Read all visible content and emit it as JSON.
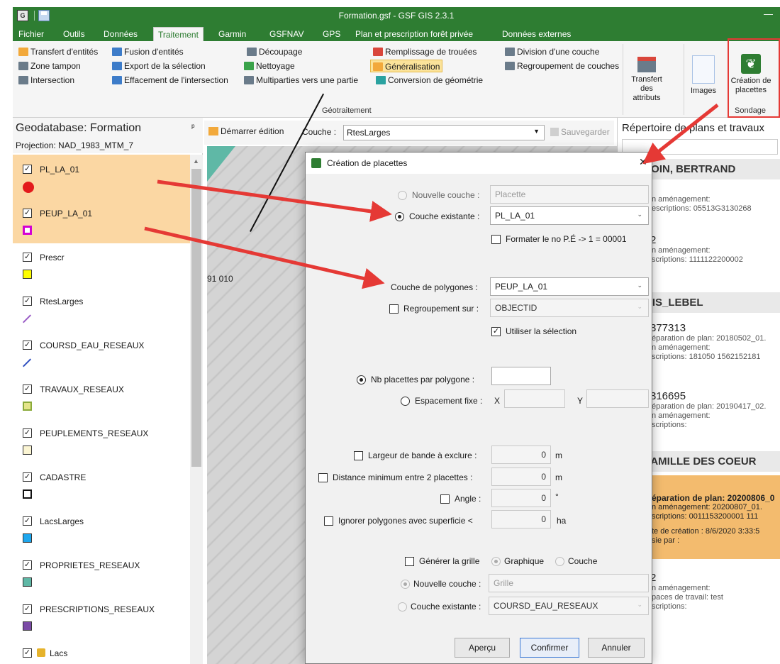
{
  "window": {
    "title": "Formation.gsf - GSF GIS 2.3.1",
    "app_icon_text": "G",
    "minimize_glyph": "—"
  },
  "tabs": [
    "Fichier",
    "Outils",
    "Données",
    "Traitement",
    "Garmin",
    "GSFNAV",
    "GPS",
    "Plan et prescription forêt privée",
    "Données externes"
  ],
  "ribbon": {
    "col1": [
      "Transfert d'entités",
      "Zone tampon",
      "Intersection"
    ],
    "col2": [
      "Fusion d'entités",
      "Export de la sélection",
      "Effacement de l'intersection"
    ],
    "col3": [
      "Découpage",
      "Nettoyage",
      "Multiparties vers une partie"
    ],
    "col4": [
      "Remplissage de trouées",
      "Généralisation",
      "Conversion de géométrie"
    ],
    "col5": [
      "Division d'une couche",
      "Regroupement de couches"
    ],
    "group_geotraitement": "Géotraitement",
    "transfert_label": "Transfert des attributs",
    "images_label": "Images",
    "creation_label": "Création de placettes",
    "group_sondage": "Sondage"
  },
  "left_panel": {
    "title": "Geodatabase: Formation",
    "pin": "ᵖ",
    "projection": "Projection: NAD_1983_MTM_7",
    "layers": [
      {
        "name": "PL_LA_01",
        "symbol": "red-dot",
        "color": "#e31a1c",
        "selected": true
      },
      {
        "name": "PEUP_LA_01",
        "symbol": "magenta-square",
        "color": "#d400d4",
        "selected": true
      },
      {
        "name": "Prescr",
        "symbol": "yellow-square",
        "color": "#ffff00"
      },
      {
        "name": "RtesLarges",
        "symbol": "purple-line",
        "color": "#9a5cc6"
      },
      {
        "name": "COURSD_EAU_RESEAUX",
        "symbol": "blue-line",
        "color": "#3050c0"
      },
      {
        "name": "TRAVAUX_RESEAUX",
        "symbol": "hatch-square",
        "color": "#e4e48a"
      },
      {
        "name": "PEUPLEMENTS_RESEAUX",
        "symbol": "cream-square",
        "color": "#fbf5d3"
      },
      {
        "name": "CADASTRE",
        "symbol": "empty-square",
        "color": "#ffffff"
      },
      {
        "name": "LacsLarges",
        "symbol": "sky-square",
        "color": "#1ea7ee"
      },
      {
        "name": "PROPRIETES_RESEAUX",
        "symbol": "teal-square",
        "color": "#5fb8a6"
      },
      {
        "name": "PRESCRIPTIONS_RESEAUX",
        "symbol": "violet-square",
        "color": "#7b4ba6"
      },
      {
        "name": "Lacs",
        "symbol": "cube",
        "color": "#e6b32c"
      }
    ]
  },
  "edit_toolbar": {
    "start_edit": "Démarrer édition",
    "couche_label": "Couche :",
    "couche_value": "RtesLarges",
    "save": "Sauvegarder"
  },
  "map": {
    "coordinate_text": "91 010"
  },
  "right_panel": {
    "title": "Répertoire de plans et travaux",
    "cards": [
      {
        "head": "LOIN, BERTRAND",
        "lines": [
          "n aménagement:",
          "escriptions:  05513G3130268"
        ]
      },
      {
        "big": "2",
        "lines": [
          "n aménagement:",
          "scriptions:  1111122200002"
        ]
      },
      {
        "head": "NIS_LEBEL"
      },
      {
        "big": "377313",
        "lines": [
          "éparation de plan: 20180502_01.",
          "n aménagement:",
          "scriptions:  181050  1562152181"
        ]
      },
      {
        "big": "316695",
        "lines": [
          "éparation de plan: 20190417_02.",
          "n aménagement:",
          "scriptions:"
        ]
      },
      {
        "head": "FAMILLE DES COEUR"
      },
      {
        "lines": [
          "éparation de plan: 20200806_0",
          "n aménagement: 20200807_01.",
          "scriptions:  0011153200001  111",
          "te de création : 8/6/2020 3:33:5",
          "sie par :"
        ]
      },
      {
        "big": "2",
        "lines": [
          "n aménagement:",
          "paces de travail:  test",
          "scriptions:"
        ]
      }
    ]
  },
  "dialog": {
    "title": "Création de placettes",
    "close": "✕",
    "nouvelle_couche_label": "Nouvelle couche :",
    "nouvelle_couche_placeholder": "Placette",
    "couche_existante_label": "Couche existante :",
    "couche_existante_value": "PL_LA_01",
    "formater_label": "Formater le no P.É -> 1 = 00001",
    "couche_polygones_label": "Couche de polygones :",
    "couche_polygones_value": "PEUP_LA_01",
    "regroupement_label": "Regroupement sur :",
    "regroupement_value": "OBJECTID",
    "utiliser_selection_label": "Utiliser la sélection",
    "nb_placettes_label": "Nb placettes par polygone :",
    "nb_placettes_value": "",
    "espacement_label": "Espacement fixe :",
    "x_label": "X",
    "y_label": "Y",
    "largeur_label": "Largeur de bande à exclure :",
    "largeur_value": "0",
    "largeur_unit": "m",
    "distance_label": "Distance minimum entre 2 placettes :",
    "distance_value": "0",
    "distance_unit": "m",
    "angle_label": "Angle :",
    "angle_value": "0",
    "angle_unit": "°",
    "ignorer_label": "Ignorer polygones avec superficie <",
    "ignorer_value": "0",
    "ignorer_unit": "ha",
    "generer_label": "Générer la grille",
    "graphique_label": "Graphique",
    "couche_label": "Couche",
    "grille_nouvelle_label": "Nouvelle couche :",
    "grille_placeholder": "Grille",
    "grille_existante_label": "Couche existante :",
    "grille_existante_value": "COURSD_EAU_RESEAUX",
    "apercu": "Aperçu",
    "confirmer": "Confirmer",
    "annuler": "Annuler"
  },
  "colors": {
    "accent_green": "#2e7d32",
    "annotation_red": "#e53935",
    "selection_orange": "#fbd7a3"
  }
}
